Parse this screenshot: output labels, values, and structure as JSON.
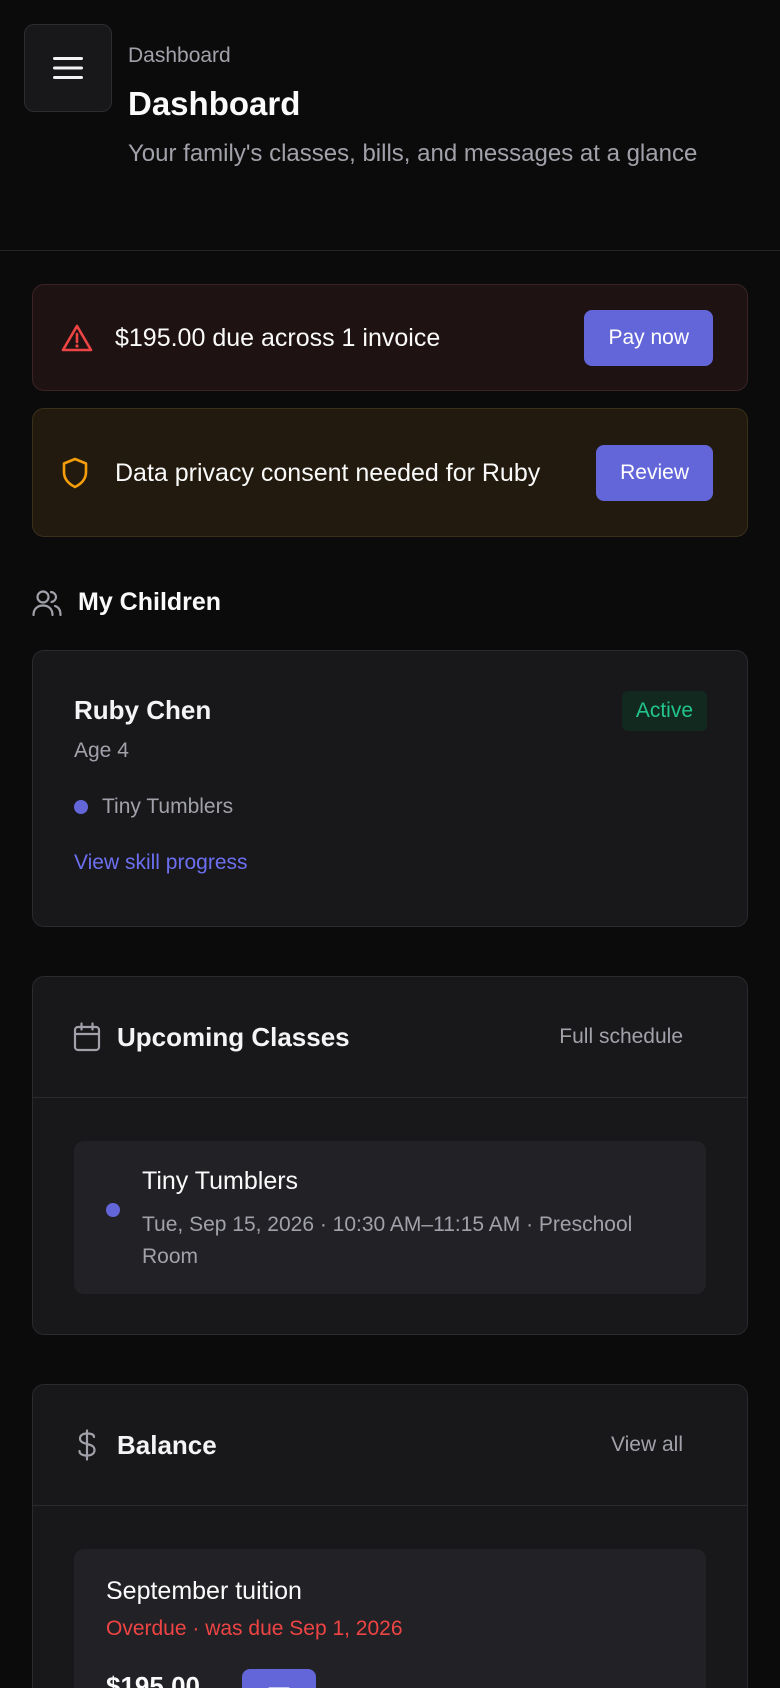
{
  "header": {
    "breadcrumb": "Dashboard",
    "title": "Dashboard",
    "subtitle": "Your family's classes, bills, and messages at a glance",
    "menu_icon": "menu-icon"
  },
  "alerts": {
    "payment": {
      "icon": "warning-icon",
      "text": "$195.00 due across 1 invoice",
      "button": "Pay now",
      "color": "#ef4444"
    },
    "privacy": {
      "icon": "shield-icon",
      "text": "Data privacy consent needed for Ruby",
      "button": "Review",
      "color": "#f59e0b"
    }
  },
  "children_section": {
    "icon": "users-icon",
    "label": "My Children",
    "children": [
      {
        "name": "Ruby Chen",
        "age": "Age 4",
        "status": "Active",
        "class": "Tiny Tumblers",
        "link": "View skill progress"
      }
    ]
  },
  "upcoming_classes": {
    "icon": "calendar-icon",
    "title": "Upcoming Classes",
    "action": "Full schedule",
    "items": [
      {
        "name": "Tiny Tumblers",
        "meta": "Tue, Sep 15, 2026 · 10:30 AM–11:15 AM · Preschool Room"
      }
    ]
  },
  "balance": {
    "icon": "dollar-icon",
    "title": "Balance",
    "action": "View all",
    "items": [
      {
        "name": "September tuition",
        "status": "Overdue · was due Sep 1, 2026",
        "amount": "$195.00",
        "button_icon": "card-icon"
      }
    ]
  },
  "colors": {
    "accent": "#6366d9",
    "danger": "#ef4444",
    "success": "#22c58b",
    "warning": "#f59e0b"
  }
}
